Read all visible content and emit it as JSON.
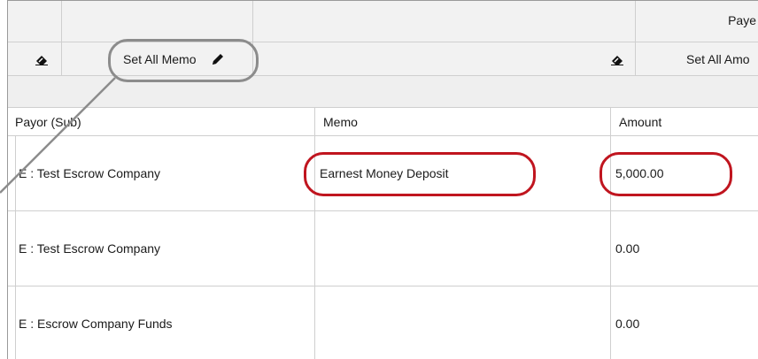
{
  "toolbar": {
    "payee_header_partial": "Paye",
    "set_all_memo_label": "Set All Memo",
    "set_all_amount_partial": "Set All Amo"
  },
  "columns": {
    "payor": "Payor (Sub)",
    "memo": "Memo",
    "amount": "Amount"
  },
  "rows": [
    {
      "payor": "E : Test Escrow Company",
      "memo": "Earnest Money Deposit",
      "amount": "5,000.00"
    },
    {
      "payor": "E : Test Escrow Company",
      "memo": "",
      "amount": "0.00"
    },
    {
      "payor": "E : Escrow Company Funds",
      "memo": "",
      "amount": "0.00"
    }
  ],
  "icons": {
    "eraser_left": "eraser-icon",
    "pencil": "pencil-icon",
    "eraser_right": "eraser-icon"
  },
  "colors": {
    "highlight_red": "#c0151f",
    "callout_gray": "#8c8c8c",
    "header_bg": "#f2f2f2",
    "grid_line": "#cfcfcf"
  }
}
